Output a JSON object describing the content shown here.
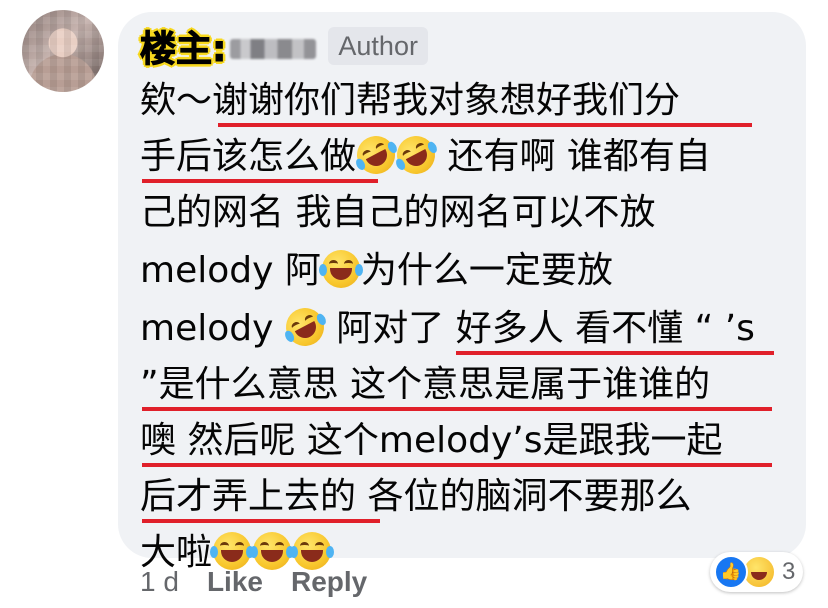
{
  "author": {
    "op_label": "楼主:",
    "badge": "Author"
  },
  "comment": {
    "lines": [
      [
        "欸～",
        "谢谢你们帮我对象想好我们分"
      ],
      [
        "手后该怎么做",
        "",
        "",
        " 还有啊 谁都有自"
      ],
      [
        "己的网名 我自己的网名可以不放"
      ],
      [
        "melody 阿",
        "",
        "为什么一定要放"
      ],
      [
        "melody ",
        "",
        " 阿对了 ",
        "好多人 看不懂 “ ’s"
      ],
      [
        "”是什么意思 这个意思是属于谁谁的"
      ],
      [
        "噢 然后呢 这个melody’s是跟我一起"
      ],
      [
        "后才弄上去的",
        " 各位的脑洞不要那么"
      ],
      [
        "大啦",
        "",
        "",
        ""
      ]
    ]
  },
  "footer": {
    "time": "1 d",
    "like": "Like",
    "reply": "Reply"
  },
  "reactions": {
    "count": "3",
    "types": [
      "like-icon",
      "haha-icon"
    ]
  },
  "colors": {
    "bubble": "#f0f2f5",
    "underline": "#e0202a",
    "highlight": "#f7d81f"
  }
}
